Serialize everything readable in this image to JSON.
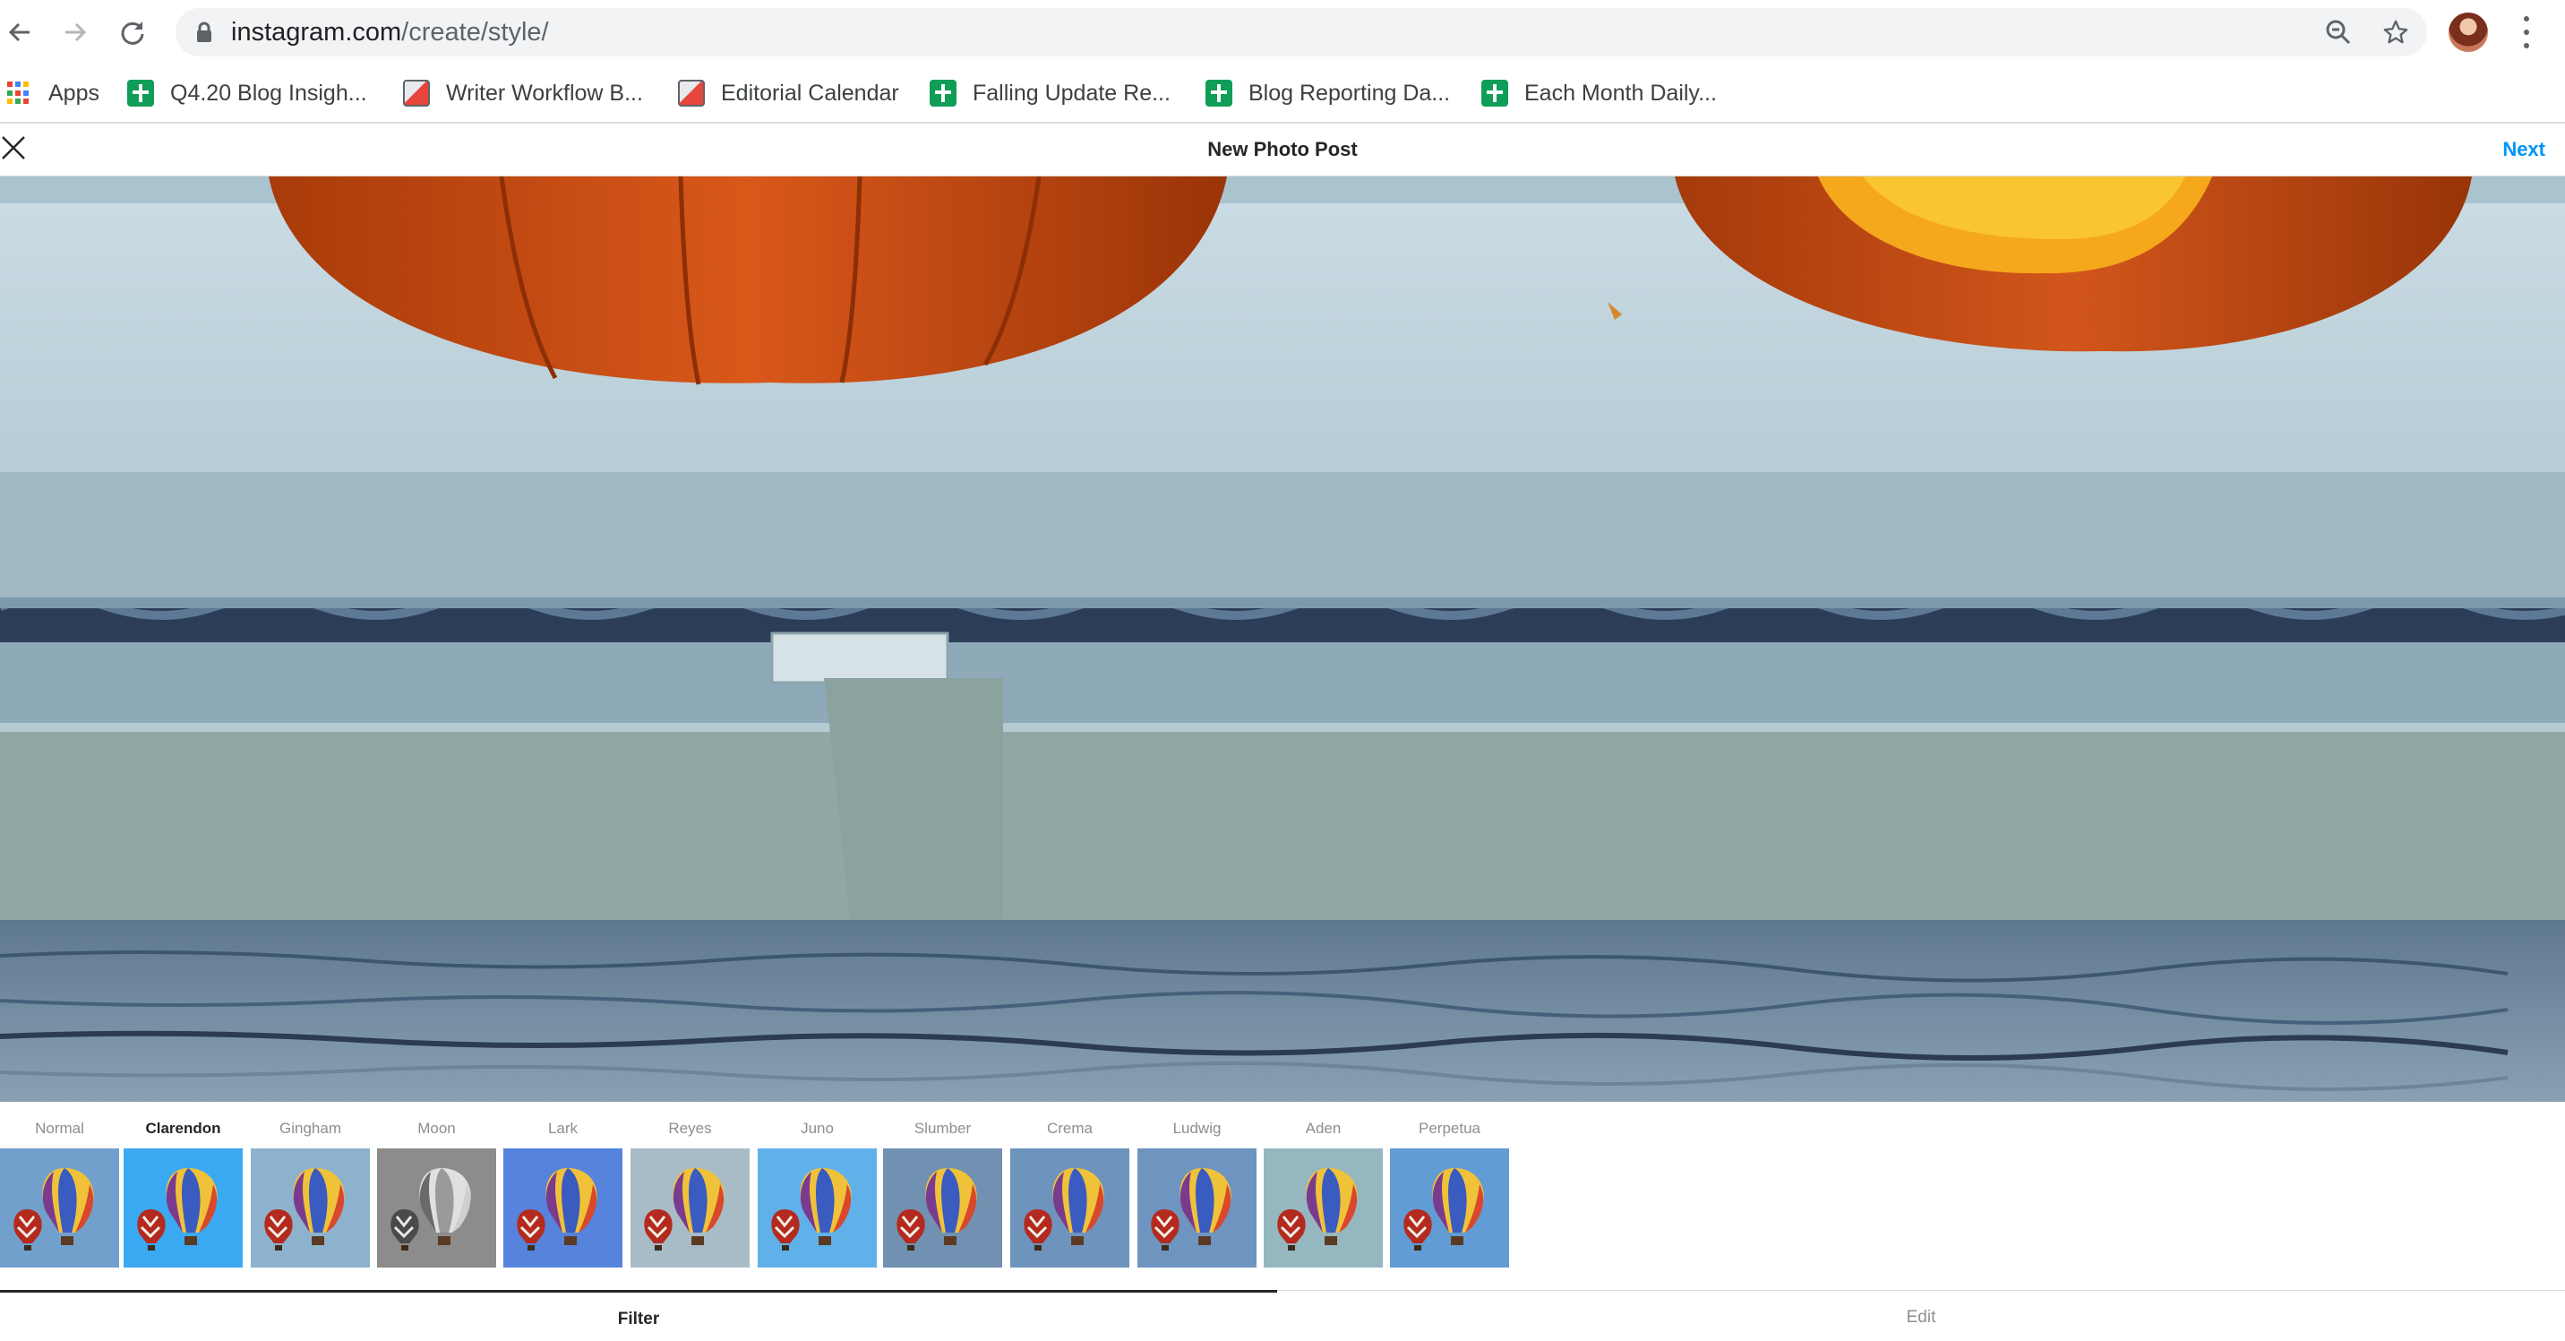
{
  "browser": {
    "url_host": "instagram.com",
    "url_path": "/create/style/",
    "icons": [
      "back-icon",
      "forward-icon",
      "reload-icon",
      "lock-icon",
      "zoom-icon",
      "star-icon",
      "avatar",
      "more-icon"
    ]
  },
  "bookmarks": [
    {
      "label": "Apps",
      "icon": "apps-grid"
    },
    {
      "label": "Q4.20 Blog Insigh...",
      "icon": "sheets"
    },
    {
      "label": "Writer Workflow B...",
      "icon": "orange-doc"
    },
    {
      "label": "Editorial Calendar",
      "icon": "orange-doc"
    },
    {
      "label": "Falling Update Re...",
      "icon": "sheets"
    },
    {
      "label": "Blog Reporting Da...",
      "icon": "sheets"
    },
    {
      "label": "Each Month Daily...",
      "icon": "sheets"
    }
  ],
  "header": {
    "title": "New Photo Post",
    "next_label": "Next"
  },
  "filters": {
    "selected": "Clarendon",
    "items": [
      {
        "name": "Normal",
        "tint": "#5f93c7"
      },
      {
        "name": "Clarendon",
        "tint": "#1f9ef0"
      },
      {
        "name": "Gingham",
        "tint": "#7ea8c8"
      },
      {
        "name": "Moon",
        "tint": "#7d7d7d"
      },
      {
        "name": "Lark",
        "tint": "#3f72d6"
      },
      {
        "name": "Reyes",
        "tint": "#9cb3c0"
      },
      {
        "name": "Juno",
        "tint": "#4aa7e8"
      },
      {
        "name": "Slumber",
        "tint": "#5d82a8"
      },
      {
        "name": "Crema",
        "tint": "#5a86b4"
      },
      {
        "name": "Ludwig",
        "tint": "#5b86b8"
      },
      {
        "name": "Aden",
        "tint": "#87aeb8"
      },
      {
        "name": "Perpetua",
        "tint": "#4d8fcf"
      }
    ]
  },
  "tabs": {
    "filter_label": "Filter",
    "edit_label": "Edit",
    "active": "Filter"
  },
  "colors": {
    "accent": "#0095f6",
    "text": "#262626",
    "muted": "#8e8e8e"
  }
}
